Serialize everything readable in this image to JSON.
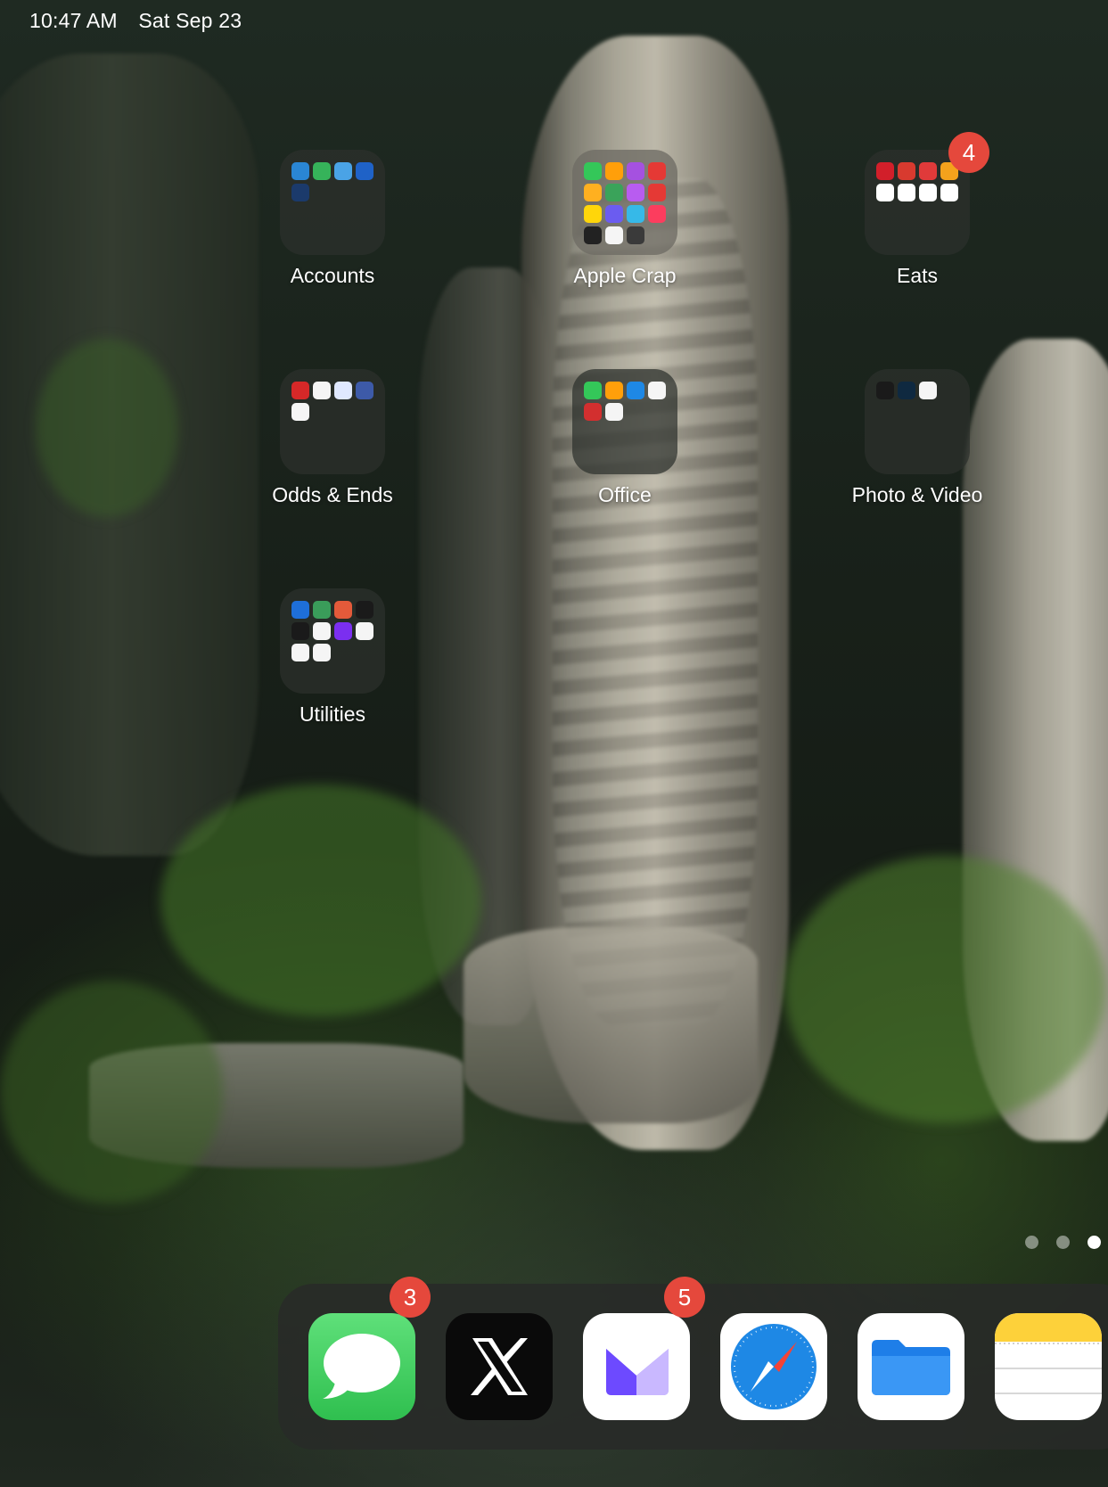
{
  "status_bar": {
    "time": "10:47 AM",
    "date": "Sat Sep 23"
  },
  "folders": [
    {
      "name": "Accounts",
      "minis": [
        "#2a86d4",
        "#36b35a",
        "#4aa3e6",
        "#1f62c7",
        "#1b3a6b"
      ]
    },
    {
      "name": "Apple Crap",
      "badge": "",
      "minis": [
        "#34c759",
        "#ff9f0a",
        "#a551e0",
        "#e53935",
        "#ffb020",
        "#3aa35a",
        "#b85cf0",
        "#e53935",
        "#ffd60a",
        "#6b5cf0",
        "#36b9e8",
        "#fc3d5e",
        "#222222",
        "#f5f5f5",
        "#3a3a3a"
      ]
    },
    {
      "name": "Eats",
      "badge": "4",
      "minis": [
        "#d21f2a",
        "#d83a2f",
        "#e03a3a",
        "#f4a21c",
        "#ffffff",
        "#ffffff",
        "#ffffff",
        "#ffffff"
      ]
    },
    {
      "name": "Odds & Ends",
      "minis": [
        "#d62828",
        "#f5f5f5",
        "#dfe8ff",
        "#3d5aa8",
        "#f5f5f5"
      ]
    },
    {
      "name": "Office",
      "minis": [
        "#34c759",
        "#ff9f0a",
        "#1e88e5",
        "#f5f5f5",
        "#d32f2f",
        "#f5f5f5"
      ]
    },
    {
      "name": "Photo & Video",
      "minis": [
        "#1a1a1a",
        "#0f2940",
        "#f5f5f5"
      ]
    },
    {
      "name": "Utilities",
      "minis": [
        "#1e6fd9",
        "#3a9d5a",
        "#e35a3a",
        "#1a1a1a",
        "#1a1a1a",
        "#f5f5f5",
        "#7b2ff0",
        "#f5f5f5",
        "#f5f5f5",
        "#f5f5f5"
      ]
    }
  ],
  "page_dots": {
    "count": 3,
    "active": 3
  },
  "dock": [
    {
      "name": "Messages",
      "badge": "3",
      "color": "#34c759"
    },
    {
      "name": "X",
      "badge": "",
      "color": "#000000"
    },
    {
      "name": "Proton Mail",
      "badge": "5",
      "color": "#ffffff"
    },
    {
      "name": "Safari",
      "badge": "",
      "color": "#ffffff"
    },
    {
      "name": "Files",
      "badge": "",
      "color": "#ffffff"
    },
    {
      "name": "Notes",
      "badge": "",
      "color": "#ffffff"
    }
  ]
}
